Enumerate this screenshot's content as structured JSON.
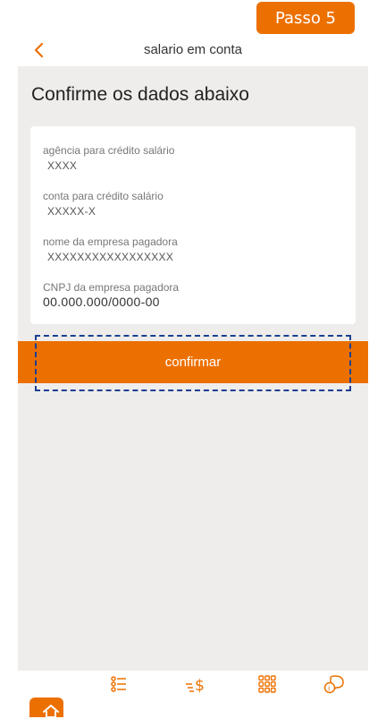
{
  "step_badge": "Passo 5",
  "header": {
    "title": "salario em conta"
  },
  "page_title": "Confirme os dados abaixo",
  "fields": [
    {
      "label": "agência para crédito salário",
      "value": "XXXX"
    },
    {
      "label": "conta para crédito salário",
      "value": "XXXXX-X"
    },
    {
      "label": "nome da empresa pagadora",
      "value": "XXXXXXXXXXXXXXXXX"
    },
    {
      "label": "CNPJ da empresa pagadora",
      "value": "00.000.000/0000-00"
    }
  ],
  "confirm_label": "confirmar",
  "colors": {
    "accent": "#ec7000",
    "background": "#efedeb",
    "highlight": "#1d3f8f"
  },
  "tabbar": {
    "items": [
      {
        "icon": "home-icon",
        "active": true
      },
      {
        "icon": "list-icon",
        "active": false
      },
      {
        "icon": "transfer-money-icon",
        "active": false
      },
      {
        "icon": "grid-menu-icon",
        "active": false
      },
      {
        "icon": "chat-help-icon",
        "active": false
      }
    ]
  }
}
